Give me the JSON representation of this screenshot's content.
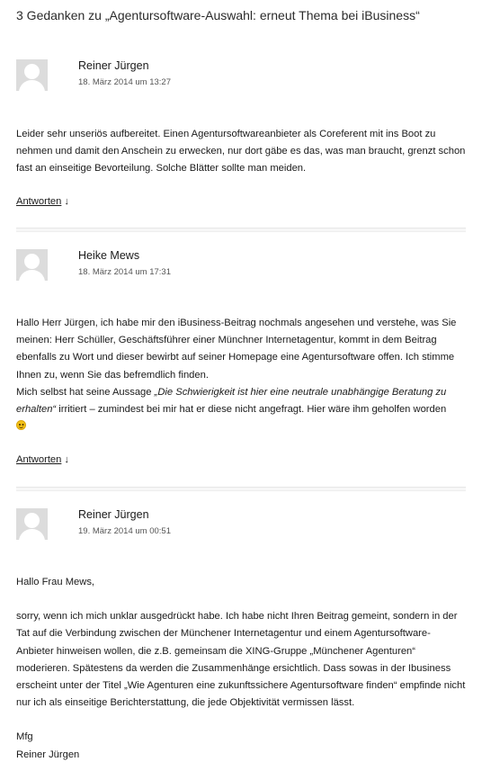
{
  "heading": "3 Gedanken zu „Agentursoftware-Auswahl: erneut Thema bei iBusiness“",
  "reply_arrow": "↓",
  "comments": [
    {
      "author": "Reiner Jürgen",
      "date": "18. März 2014 um 13:27",
      "paragraphs": [
        "Leider sehr unseriös aufbereitet. Einen Agentursoftwareanbieter als Coreferent mit ins Boot zu nehmen und damit den Anschein zu erwecken, nur dort gäbe es das, was man braucht, grenzt schon fast an einseitige Bevorteilung. Solche Blätter sollte man meiden."
      ],
      "reply_label": "Antworten"
    },
    {
      "author": "Heike Mews",
      "date": "18. März 2014 um 17:31",
      "line1": "Hallo Herr Jürgen, ich habe mir den iBusiness-Beitrag nochmals angesehen und verstehe, was Sie meinen: Herr Schüller, Geschäftsführer einer Münchner Internetagentur, kommt in dem Beitrag ebenfalls zu Wort und dieser bewirbt auf seiner Homepage eine Agentursoftware offen. Ich stimme Ihnen zu, wenn Sie das befremdlich finden.",
      "line2_pre": "Mich selbst hat seine Aussage ",
      "line2_quote": "„Die Schwierigkeit ist hier eine neutrale unabhängige Beratung zu erhalten“",
      "line2_post": " irritiert – zumindest bei mir hat er diese nicht angefragt. Hier wäre ihm geholfen worden",
      "smiley": "smile-emoji",
      "reply_label": "Antworten"
    },
    {
      "author": "Reiner Jürgen",
      "date": "19. März 2014 um 00:51",
      "paragraphs": [
        "Hallo Frau Mews,",
        "sorry, wenn ich mich unklar ausgedrückt habe. Ich habe nicht Ihren Beitrag gemeint, sondern in der Tat auf die Verbindung zwischen der Münchener Internetagentur und einem Agentursoftware-Anbieter hinweisen wollen, die z.B. gemeinsam die XING-Gruppe „Münchener Agenturen“ moderieren. Spätestens da werden die Zusammenhänge ersichtlich. Dass sowas in der Ibusiness erscheint unter der Titel „Wie Agenturen eine zukunftssichere Agentursoftware finden“ empfinde nicht nur ich als einseitige Berichterstattung, die jede Objektivität vermissen lässt.",
        "Mfg",
        "Reiner Jürgen"
      ]
    }
  ]
}
